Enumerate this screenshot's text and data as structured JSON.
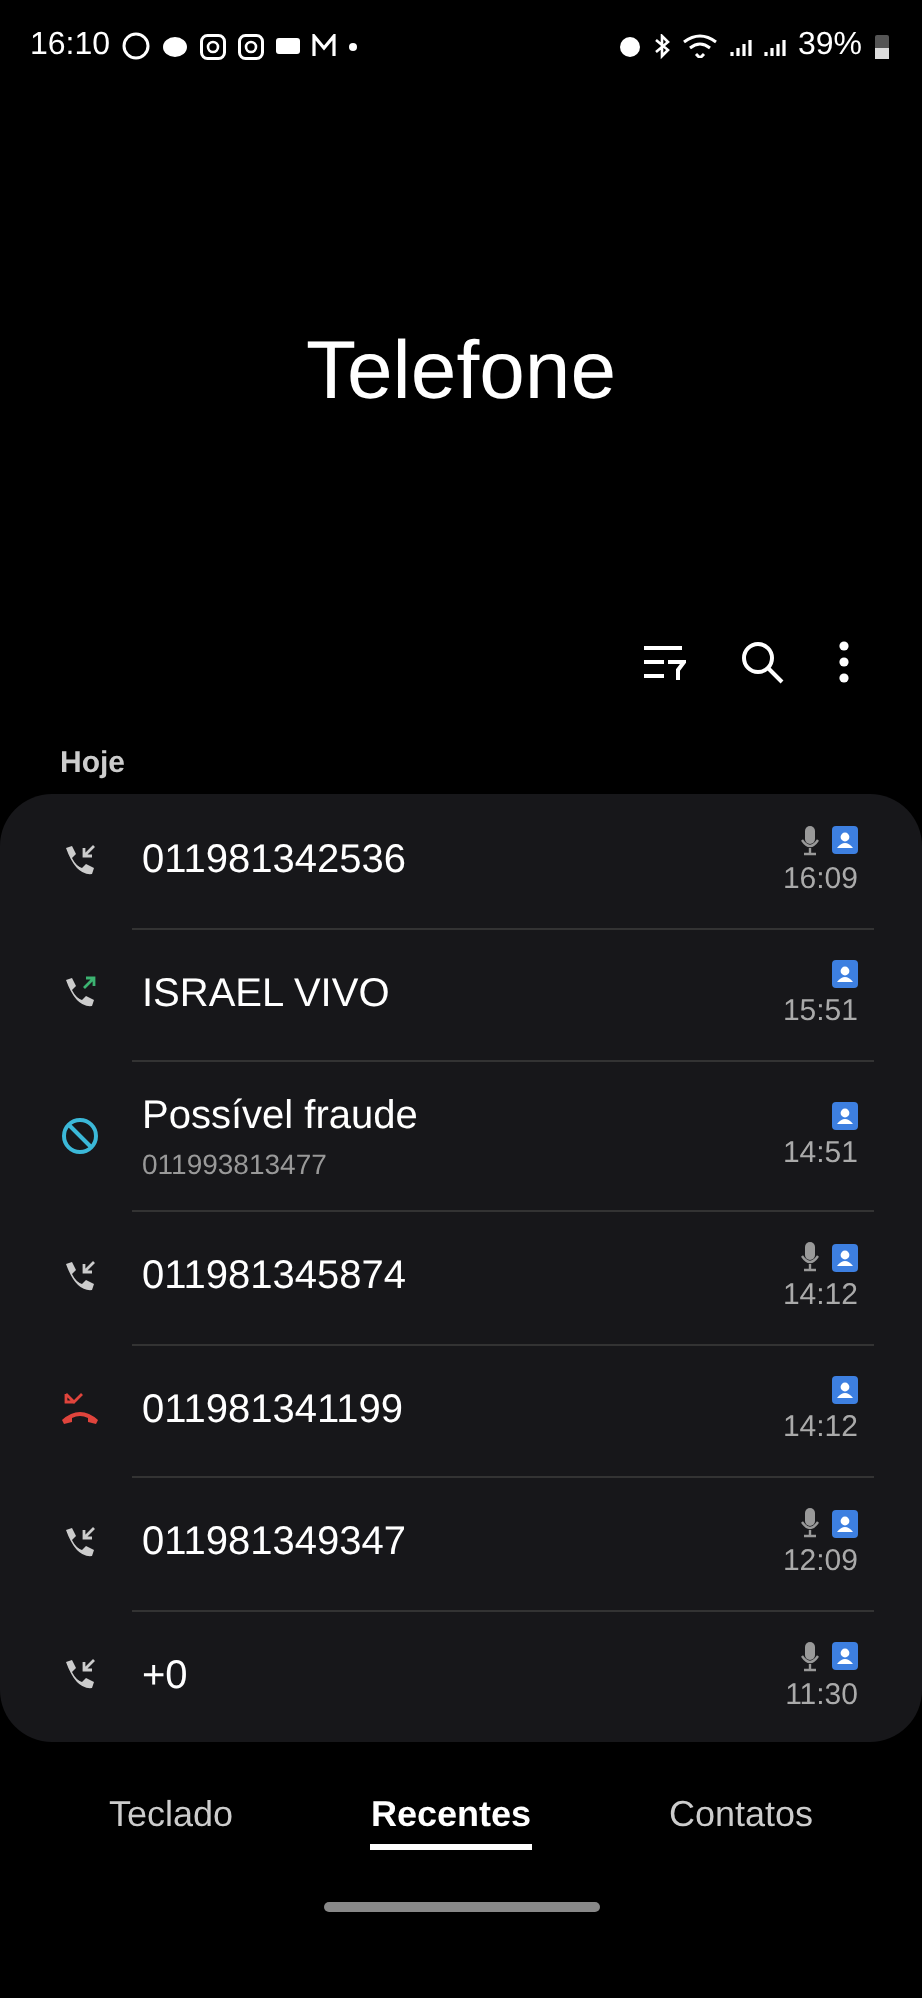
{
  "status_bar": {
    "time": "16:10",
    "battery": "39%"
  },
  "title": "Telefone",
  "section": "Hoje",
  "calls": [
    {
      "kind": "incoming",
      "name": "011981342536",
      "recorded": true,
      "time": "16:09"
    },
    {
      "kind": "outgoing",
      "name": "ISRAEL VIVO",
      "recorded": false,
      "time": "15:51"
    },
    {
      "kind": "blocked",
      "name": "Possível fraude",
      "number": "011993813477",
      "recorded": false,
      "time": "14:51"
    },
    {
      "kind": "incoming",
      "name": "011981345874",
      "recorded": true,
      "time": "14:12"
    },
    {
      "kind": "missed",
      "name": "011981341199",
      "recorded": false,
      "time": "14:12"
    },
    {
      "kind": "incoming",
      "name": "011981349347",
      "recorded": true,
      "time": "12:09"
    },
    {
      "kind": "incoming",
      "name": "+0",
      "recorded": true,
      "time": "11:30"
    }
  ],
  "tabs": [
    {
      "label": "Teclado",
      "selected": false
    },
    {
      "label": "Recentes",
      "selected": true
    },
    {
      "label": "Contatos",
      "selected": false
    }
  ]
}
